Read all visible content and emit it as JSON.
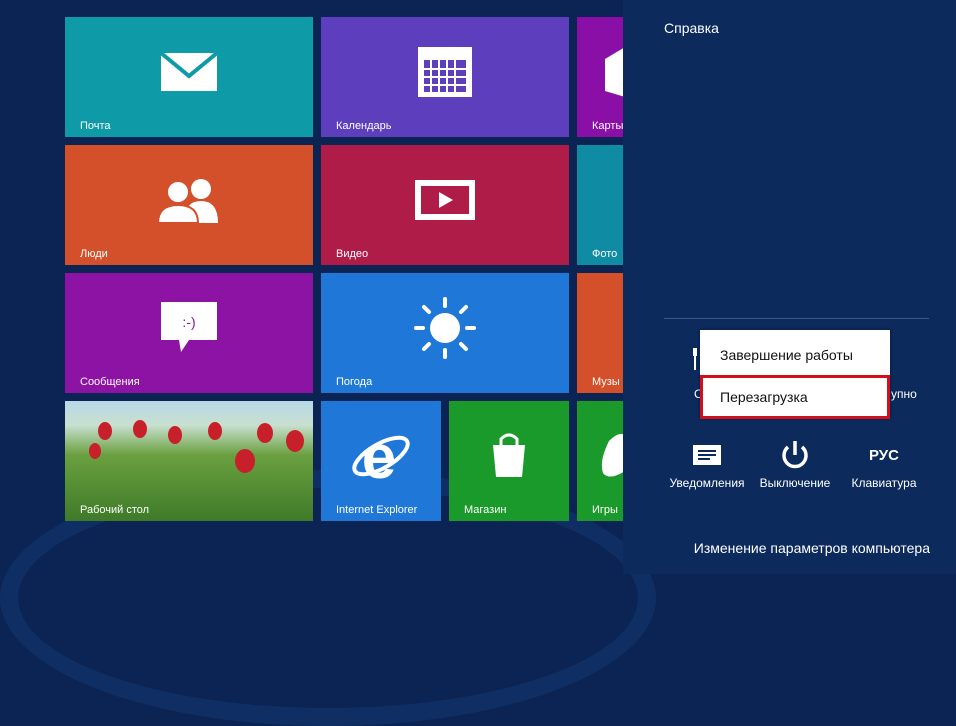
{
  "tiles": [
    {
      "label": "Почта",
      "color": "#0f9aa8",
      "icon": "mail-icon"
    },
    {
      "label": "Календарь",
      "color": "#5d3ebc",
      "icon": "calendar-icon"
    },
    {
      "label": "Карты",
      "color": "#8a0fa6",
      "icon": "maps-icon"
    },
    {
      "label": "Люди",
      "color": "#d4502a",
      "icon": "people-icon"
    },
    {
      "label": "Видео",
      "color": "#b01c48",
      "icon": "video-icon"
    },
    {
      "label": "Фото",
      "color": "#0f8ba3",
      "icon": "photos-icon"
    },
    {
      "label": "Сообщения",
      "color": "#8d13a4",
      "icon": "messaging-icon"
    },
    {
      "label": "Погода",
      "color": "#1f78d8",
      "icon": "weather-icon"
    },
    {
      "label": "Музы",
      "color": "#d4502a",
      "icon": "music-icon"
    },
    {
      "label": "Рабочий стол",
      "color": "#6a9a3a",
      "icon": "desktop-icon"
    },
    {
      "label": "Internet Explorer",
      "color": "#1f78d8",
      "icon": "ie-icon"
    },
    {
      "label": "Магазин",
      "color": "#1a9a2a",
      "icon": "store-icon"
    },
    {
      "label": "Игры",
      "color": "#1a9a2a",
      "icon": "games-icon"
    }
  ],
  "panel": {
    "help": "Справка",
    "partial_left": "С",
    "partial_right": "упно",
    "power_menu": [
      "Завершение работы",
      "Перезагрузка"
    ],
    "quick": [
      {
        "label": "Уведомления",
        "icon": "notifications-icon"
      },
      {
        "label": "Выключение",
        "icon": "power-icon"
      },
      {
        "label": "Клавиатура",
        "icon_text": "РУС"
      }
    ],
    "settings_link": "Изменение параметров компьютера"
  }
}
